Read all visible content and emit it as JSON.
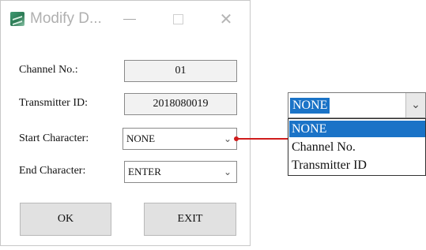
{
  "window": {
    "title": "Modify D...",
    "close_glyph": "✕"
  },
  "form": {
    "channel": {
      "label": "Channel No.:",
      "value": "01"
    },
    "transmitter": {
      "label": "Transmitter ID:",
      "value": "2018080019"
    },
    "start": {
      "label": "Start Character:",
      "value": "NONE"
    },
    "end": {
      "label": "End Character:",
      "value": "ENTER"
    }
  },
  "buttons": {
    "ok": "OK",
    "exit": "EXIT"
  },
  "dropdown_zoom": {
    "selected": "NONE",
    "options": [
      "NONE",
      "Channel No.",
      "Transmitter ID"
    ]
  },
  "icons": {
    "app": "app-icon",
    "minimize": "minimize-icon",
    "maximize": "maximize-icon",
    "close": "close-icon",
    "chevron": "chevron-down-icon"
  },
  "colors": {
    "highlight": "#1a73c7",
    "connector": "#d01c1c"
  }
}
